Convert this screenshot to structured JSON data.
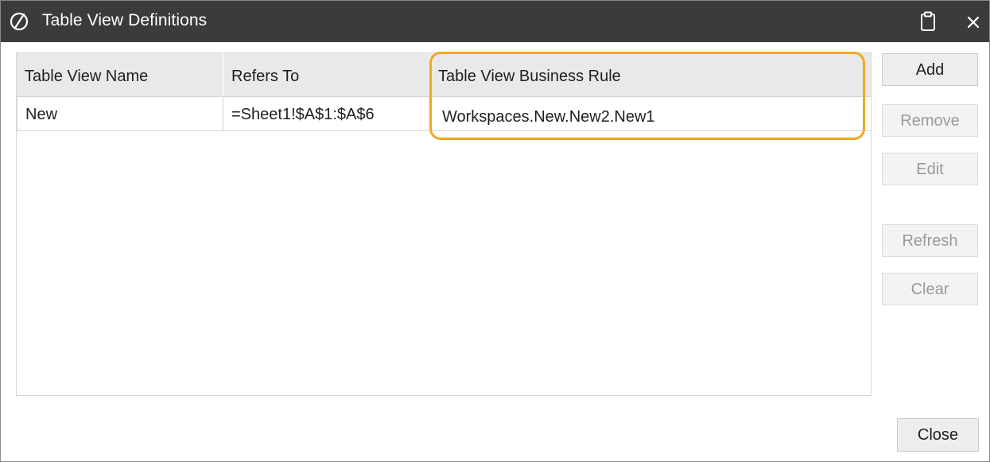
{
  "window": {
    "title": "Table View Definitions",
    "icons": {
      "app": "onestream-logo-icon",
      "clipboard": "clipboard-icon",
      "close": "close-icon"
    }
  },
  "table": {
    "columns": [
      "Table View Name",
      "Refers To",
      "Table View Business Rule"
    ],
    "rows": [
      {
        "name": "New",
        "refers_to": "=Sheet1!$A$1:$A$6",
        "business_rule": "Workspaces.New.New2.New1"
      }
    ],
    "highlight_color": "#f0a820"
  },
  "buttons": {
    "add": {
      "label": "Add",
      "enabled": true
    },
    "remove": {
      "label": "Remove",
      "enabled": false
    },
    "edit": {
      "label": "Edit",
      "enabled": false
    },
    "refresh": {
      "label": "Refresh",
      "enabled": false
    },
    "clear": {
      "label": "Clear",
      "enabled": false
    },
    "close": {
      "label": "Close",
      "enabled": true
    }
  },
  "colors": {
    "titlebar": "#3b3b3b",
    "header_bg": "#e9e9e9",
    "disabled_text": "#9a9a9a"
  }
}
